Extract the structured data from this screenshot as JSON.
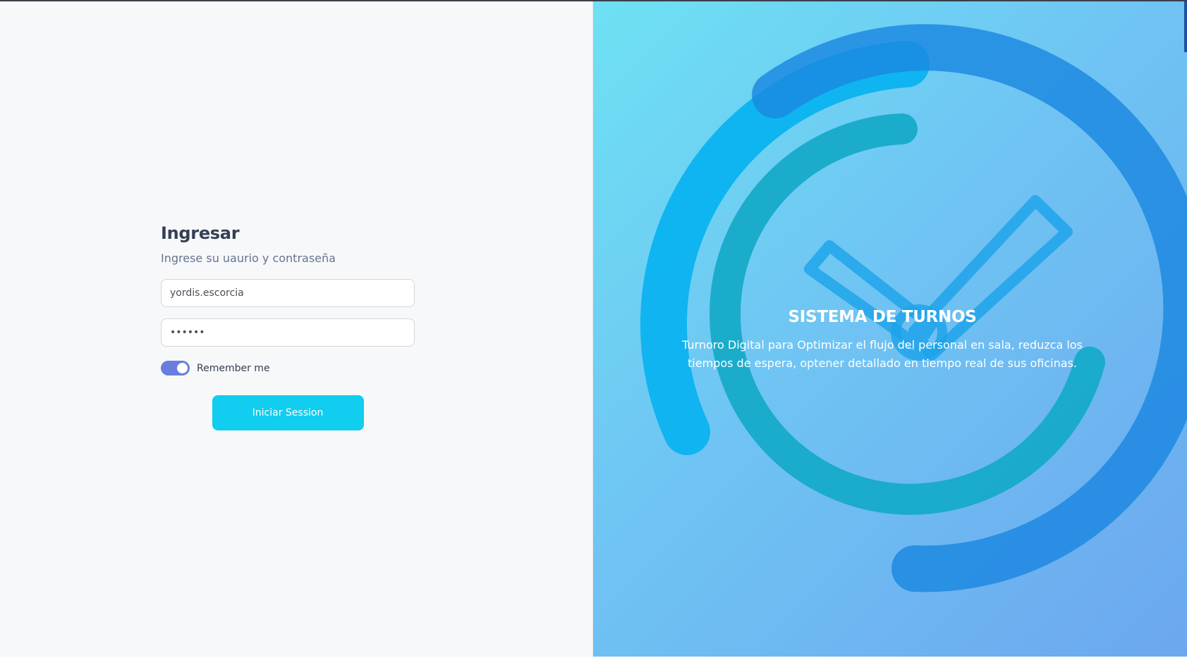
{
  "login": {
    "title": "Ingresar",
    "subtitle": "Ingrese su uaurio y contraseña",
    "username_value": "yordis.escorcia",
    "password_value": "......",
    "remember_label": "Remember me",
    "remember_checked": true,
    "submit_label": "Iniciar Session"
  },
  "hero": {
    "title": "SISTEMA DE TURNOS",
    "description": "Turnoro Digital para Optimizar el flujo del personal en sala, reduzca los tiempos de espera, optener detallado en tiempo real de sus oficinas.",
    "illustration": "clock-icon"
  },
  "colors": {
    "accent": "#11cdef",
    "toggle": "#6a7dde",
    "heading": "#344054",
    "gradient_start": "#6ee1f3",
    "gradient_end": "#6ca7ef"
  }
}
